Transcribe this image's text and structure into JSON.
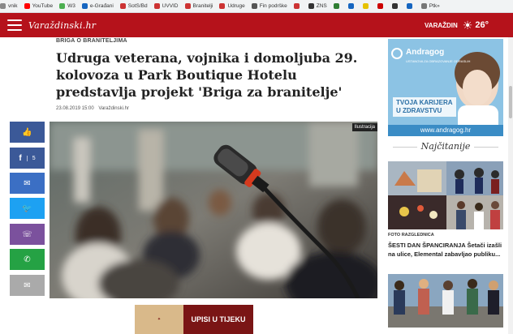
{
  "bookmarks": [
    {
      "label": "vnik",
      "color": "#888888"
    },
    {
      "label": "YouTube",
      "color": "#ff0000"
    },
    {
      "label": "W3",
      "color": "#4caf50"
    },
    {
      "label": "e-Građani",
      "color": "#1565c0"
    },
    {
      "label": "SotS/Bd",
      "color": "#cc3333"
    },
    {
      "label": "UVVID",
      "color": "#cc3333"
    },
    {
      "label": "Branitelji",
      "color": "#cc3333"
    },
    {
      "label": "Udruge",
      "color": "#cc3333"
    },
    {
      "label": "Fin podrške",
      "color": "#555555"
    },
    {
      "label": "",
      "color": "#cc3333"
    },
    {
      "label": "ZNS",
      "color": "#333333"
    },
    {
      "label": "",
      "color": "#2e7d32"
    },
    {
      "label": "",
      "color": "#1565c0"
    },
    {
      "label": "",
      "color": "#e6c200"
    },
    {
      "label": "",
      "color": "#cc0000"
    },
    {
      "label": "",
      "color": "#333333"
    },
    {
      "label": "",
      "color": "#1565c0"
    },
    {
      "label": "Ptk»",
      "color": "#777777"
    }
  ],
  "header": {
    "logo": "Varaždinski.hr",
    "city": "VARAŽDIN",
    "temperature": "26°",
    "brand_color": "#b5121b"
  },
  "article": {
    "category": "BRIGA O BRANITELJIMA",
    "title": "Udruga veterana, vojnika i domoljuba 29. kolovoza u Park Boutique Hotelu predstavlja projekt 'Briga za branitelje'",
    "date": "23.08.2019 15:00",
    "source": "Varaždinski.hr",
    "image_label": "Ilustracija"
  },
  "share": [
    {
      "name": "like",
      "icon": "👍",
      "color": "#3b5998",
      "count": ""
    },
    {
      "name": "facebook",
      "icon": "f",
      "color": "#3b5998",
      "count": "5"
    },
    {
      "name": "messenger",
      "icon": "✉",
      "color": "#3b6fc4",
      "count": ""
    },
    {
      "name": "twitter",
      "icon": "🐦",
      "color": "#1da1f2",
      "count": ""
    },
    {
      "name": "viber",
      "icon": "☏",
      "color": "#7b519d",
      "count": ""
    },
    {
      "name": "whatsapp",
      "icon": "✆",
      "color": "#25a244",
      "count": ""
    },
    {
      "name": "email",
      "icon": "✉",
      "color": "#aaaaaa",
      "count": ""
    }
  ],
  "ad": {
    "brand": "Andragog",
    "tagline": "USTANOVA ZA OBRAZOVANJE ODRASLIH",
    "line1": "TVOJA KARIJERA",
    "line2": "U ZDRAVSTVU",
    "url": "www.andragog.hr"
  },
  "bottom_ad": {
    "text": "UPISI U TIJEKU"
  },
  "sidebar": {
    "rubric": "Najčitanije",
    "foto_category": "FOTO RAZGLEDNICA",
    "foto_title": "ŠESTI DAN ŠPANCIRANJA Šetači izašli na ulice, Elemental zabavljao publiku..."
  }
}
